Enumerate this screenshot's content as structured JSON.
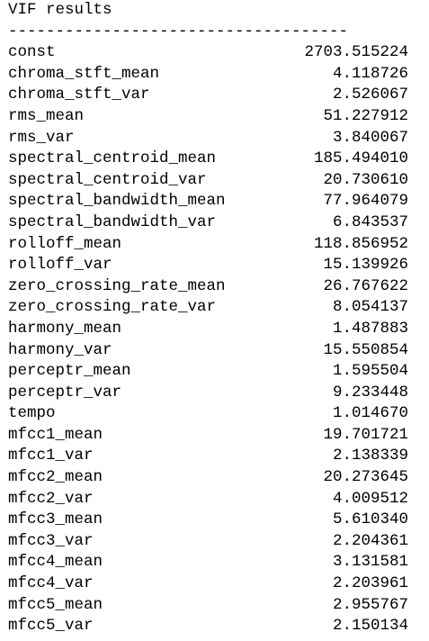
{
  "title": "VIF results",
  "separator": "------------------------------------",
  "rows": [
    {
      "name": "const",
      "value": "2703.515224"
    },
    {
      "name": "chroma_stft_mean",
      "value": "4.118726"
    },
    {
      "name": "chroma_stft_var",
      "value": "2.526067"
    },
    {
      "name": "rms_mean",
      "value": "51.227912"
    },
    {
      "name": "rms_var",
      "value": "3.840067"
    },
    {
      "name": "spectral_centroid_mean",
      "value": "185.494010"
    },
    {
      "name": "spectral_centroid_var",
      "value": "20.730610"
    },
    {
      "name": "spectral_bandwidth_mean",
      "value": "77.964079"
    },
    {
      "name": "spectral_bandwidth_var",
      "value": "6.843537"
    },
    {
      "name": "rolloff_mean",
      "value": "118.856952"
    },
    {
      "name": "rolloff_var",
      "value": "15.139926"
    },
    {
      "name": "zero_crossing_rate_mean",
      "value": "26.767622"
    },
    {
      "name": "zero_crossing_rate_var",
      "value": "8.054137"
    },
    {
      "name": "harmony_mean",
      "value": "1.487883"
    },
    {
      "name": "harmony_var",
      "value": "15.550854"
    },
    {
      "name": "perceptr_mean",
      "value": "1.595504"
    },
    {
      "name": "perceptr_var",
      "value": "9.233448"
    },
    {
      "name": "tempo",
      "value": "1.014670"
    },
    {
      "name": "mfcc1_mean",
      "value": "19.701721"
    },
    {
      "name": "mfcc1_var",
      "value": "2.138339"
    },
    {
      "name": "mfcc2_mean",
      "value": "20.273645"
    },
    {
      "name": "mfcc2_var",
      "value": "4.009512"
    },
    {
      "name": "mfcc3_mean",
      "value": "5.610340"
    },
    {
      "name": "mfcc3_var",
      "value": "2.204361"
    },
    {
      "name": "mfcc4_mean",
      "value": "3.131581"
    },
    {
      "name": "mfcc4_var",
      "value": "2.203961"
    },
    {
      "name": "mfcc5_mean",
      "value": "2.955767"
    },
    {
      "name": "mfcc5_var",
      "value": "2.150134"
    }
  ]
}
